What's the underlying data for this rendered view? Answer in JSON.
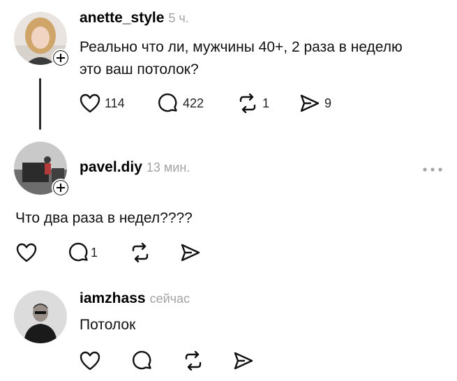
{
  "post": {
    "username": "anette_style",
    "time": "5 ч.",
    "text_line1": "Реально что ли, мужчины 40+, 2 раза в неделю",
    "text_line2": "это ваш потолок?",
    "likes": "114",
    "comments": "422",
    "reposts": "1",
    "shares": "9"
  },
  "reply1": {
    "username": "pavel.diy",
    "time": "13 мин.",
    "text": "Что два раза в недел????",
    "comments": "1"
  },
  "reply2": {
    "username": "iamzhass",
    "time": "сейчас",
    "text": "Потолок"
  },
  "icons": {
    "like": "heart-icon",
    "comment": "speech-bubble-icon",
    "repost": "repost-arrows-icon",
    "share": "paper-plane-icon",
    "more": "more-dots-icon",
    "follow": "plus-icon"
  }
}
